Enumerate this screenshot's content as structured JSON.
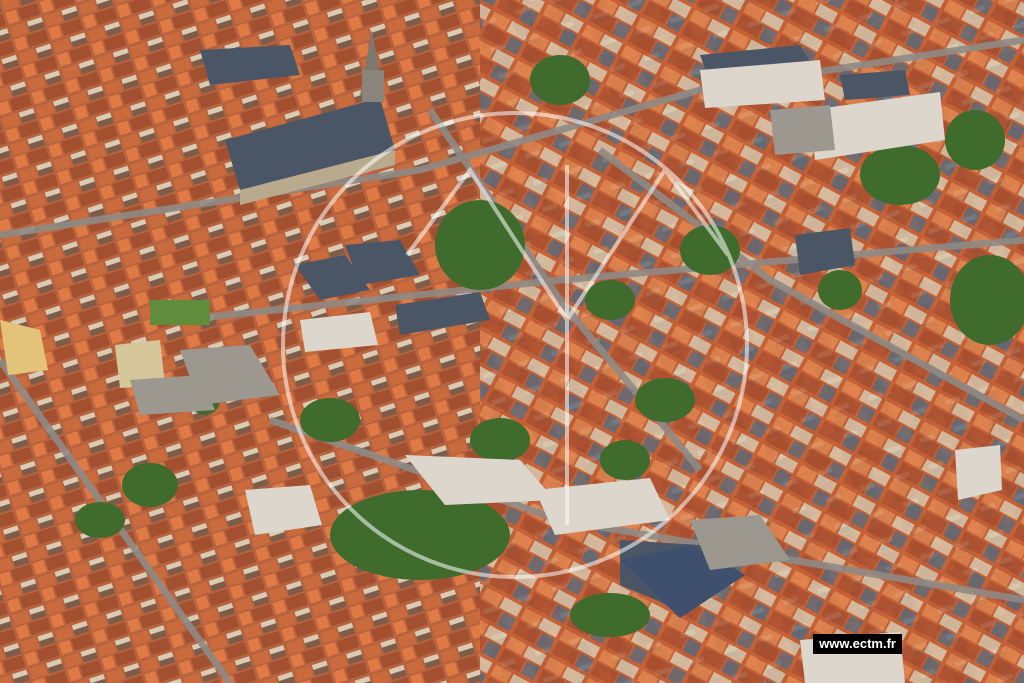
{
  "photo": {
    "kind": "aerial photograph of a dense town with red-tiled roofs, a church and green courtyards",
    "palette": {
      "roof": "#c8623a",
      "roof_dark": "#9b4a2f",
      "slate": "#4a5566",
      "wall": "#d9cbb4",
      "green": "#3f6b2c",
      "street": "#8f8a85"
    }
  },
  "watermark": {
    "icon": "circular-monogram-watermark",
    "credit_text": "www.ectm.fr"
  }
}
